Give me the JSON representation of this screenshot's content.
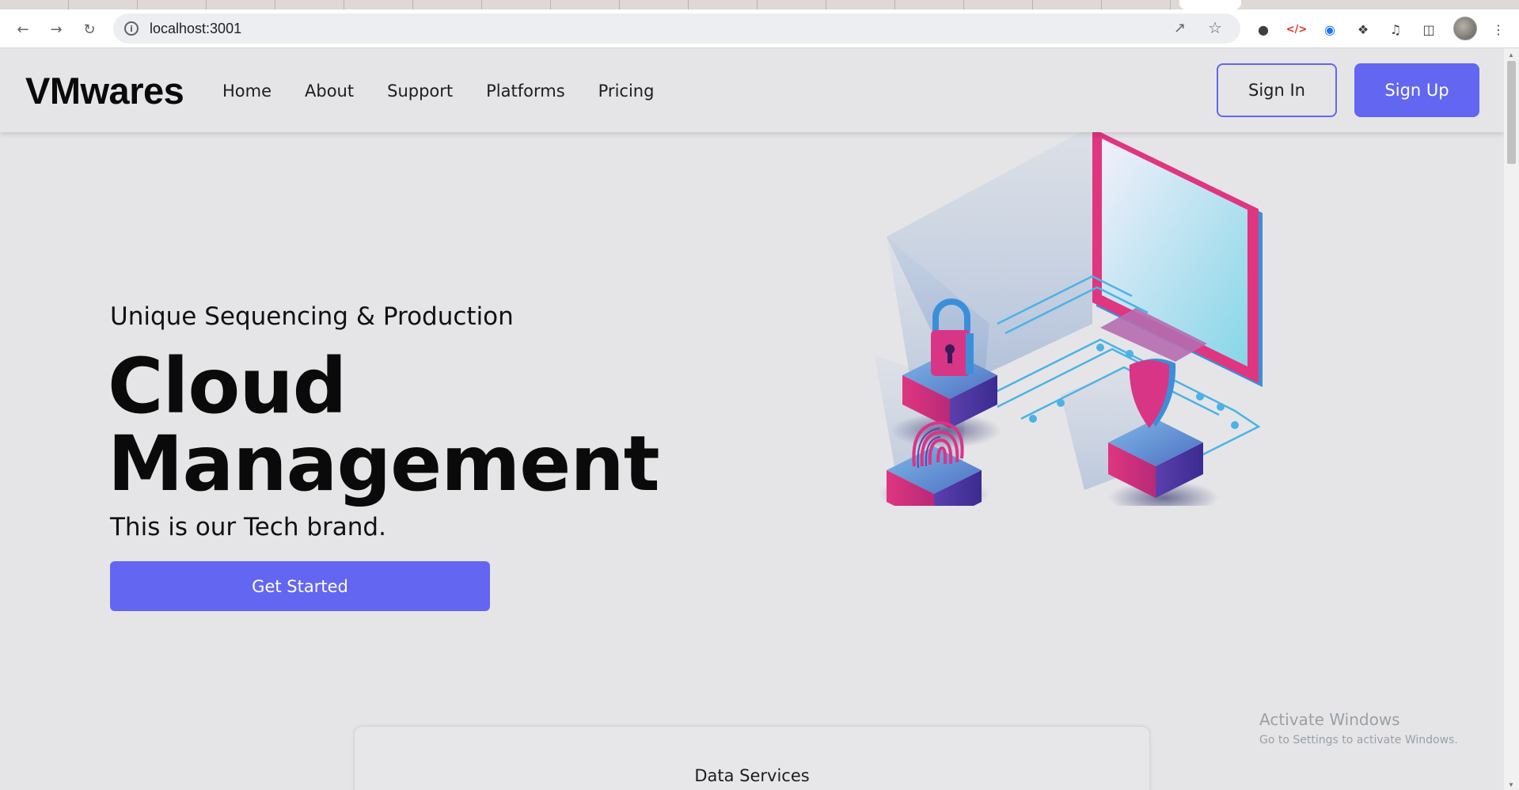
{
  "browser": {
    "url": "localhost:3001",
    "back_icon": "arrow-left-icon",
    "forward_icon": "arrow-right-icon",
    "reload_icon": "reload-icon"
  },
  "navbar": {
    "brand": "VMwares",
    "links": [
      "Home",
      "About",
      "Support",
      "Platforms",
      "Pricing"
    ],
    "sign_in": "Sign In",
    "sign_up": "Sign Up"
  },
  "hero": {
    "subtitle": "Unique Sequencing & Production",
    "title_line1": "Cloud",
    "title_line2": "Management",
    "description": "This is our Tech brand.",
    "cta": "Get Started"
  },
  "services": {
    "label": "Data Services"
  },
  "watermark": {
    "line1": "Activate Windows",
    "line2": "Go to Settings to activate Windows."
  },
  "colors": {
    "accent": "#6366f1",
    "background": "#e5e5e8",
    "illustration_pink": "#e0357f",
    "illustration_blue": "#3b8fd9"
  }
}
